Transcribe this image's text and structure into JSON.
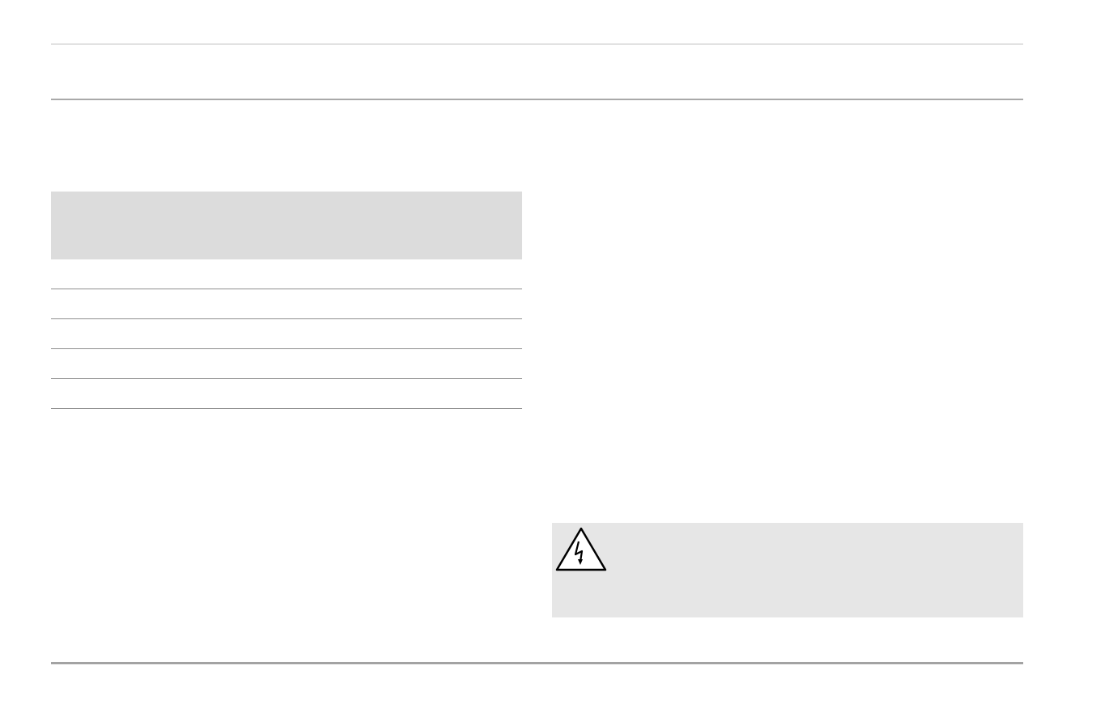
{
  "header": {
    "title": ""
  },
  "spec_table": {
    "columns": [],
    "rows": [
      {
        "cells": []
      },
      {
        "cells": []
      },
      {
        "cells": []
      },
      {
        "cells": []
      },
      {
        "cells": []
      }
    ]
  },
  "warning": {
    "icon": "electrical-hazard-icon",
    "text": ""
  },
  "footer": {
    "page_number": ""
  }
}
